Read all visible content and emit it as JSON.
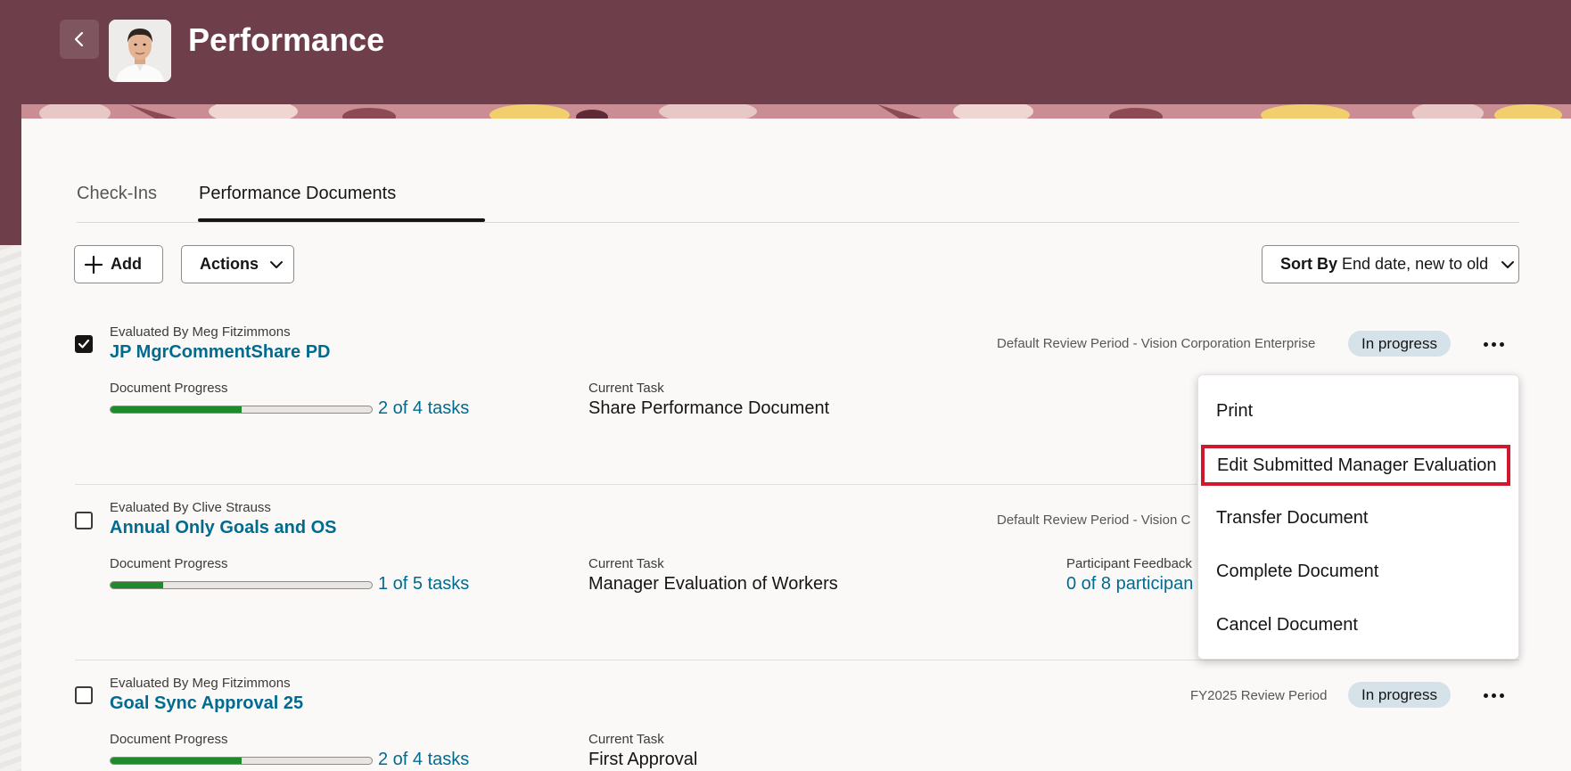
{
  "header": {
    "title": "Performance",
    "back_icon": "chevron-left-icon",
    "background": "#6e3e4a"
  },
  "tabs": [
    {
      "label": "Check-Ins",
      "active": false
    },
    {
      "label": "Performance Documents",
      "active": true
    }
  ],
  "toolbar": {
    "add_label": "Add",
    "actions_label": "Actions",
    "sort_prefix": "Sort By",
    "sort_value": "End date, new to old"
  },
  "documents": [
    {
      "checked": true,
      "evaluated_by": "Evaluated By Meg Fitzimmons",
      "title": "JP MgrCommentShare PD",
      "review_period": "Default Review Period - Vision Corporation Enterprise",
      "status": "In progress",
      "progress_label": "Document Progress",
      "progress_fraction": 0.5,
      "progress_text": "2 of 4 tasks",
      "current_task_label": "Current Task",
      "current_task": "Share Performance Document"
    },
    {
      "checked": false,
      "evaluated_by": "Evaluated By Clive Strauss",
      "title": "Annual Only Goals and OS",
      "review_period": "Default Review Period - Vision C",
      "progress_label": "Document Progress",
      "progress_fraction": 0.2,
      "progress_text": "1 of 5 tasks",
      "current_task_label": "Current Task",
      "current_task": "Manager Evaluation of Workers",
      "feedback_label": "Participant Feedback",
      "feedback_text": "0 of 8 participan"
    },
    {
      "checked": false,
      "evaluated_by": "Evaluated By Meg Fitzimmons",
      "title": "Goal Sync Approval 25",
      "review_period": "FY2025 Review Period",
      "status": "In progress",
      "progress_label": "Document Progress",
      "progress_fraction": 0.5,
      "progress_text": "2 of 4 tasks",
      "current_task_label": "Current Task",
      "current_task": "First Approval"
    }
  ],
  "menu": {
    "items": [
      {
        "label": "Print"
      },
      {
        "label": "Edit Submitted Manager Evaluation",
        "highlighted": true
      },
      {
        "label": "Transfer Document"
      },
      {
        "label": "Complete Document"
      },
      {
        "label": "Cancel Document"
      }
    ]
  },
  "colors": {
    "accent_link": "#006b8f",
    "progress_fill": "#1e8a2c",
    "badge_bg": "#d5e2ea",
    "highlight_border": "#d0172b"
  }
}
